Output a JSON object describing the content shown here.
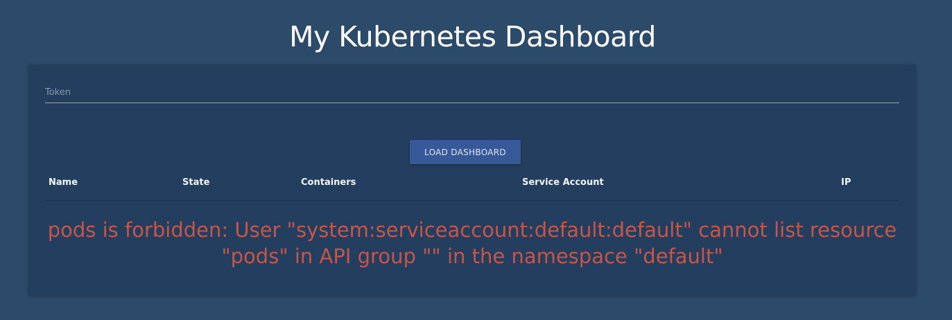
{
  "page": {
    "title": "My Kubernetes Dashboard"
  },
  "token": {
    "placeholder": "Token",
    "value": ""
  },
  "actions": {
    "load_label": "LOAD DASHBOARD"
  },
  "table": {
    "columns": [
      "Name",
      "State",
      "Containers",
      "Service Account",
      "IP"
    ],
    "rows": []
  },
  "error": {
    "message": "pods is forbidden: User \"system:serviceaccount:default:default\" cannot list resource \"pods\" in API group \"\" in the namespace \"default\""
  },
  "colors": {
    "background": "#2c4a6a",
    "card": "#233e5e",
    "button": "#37599a",
    "error": "#c7564a"
  }
}
